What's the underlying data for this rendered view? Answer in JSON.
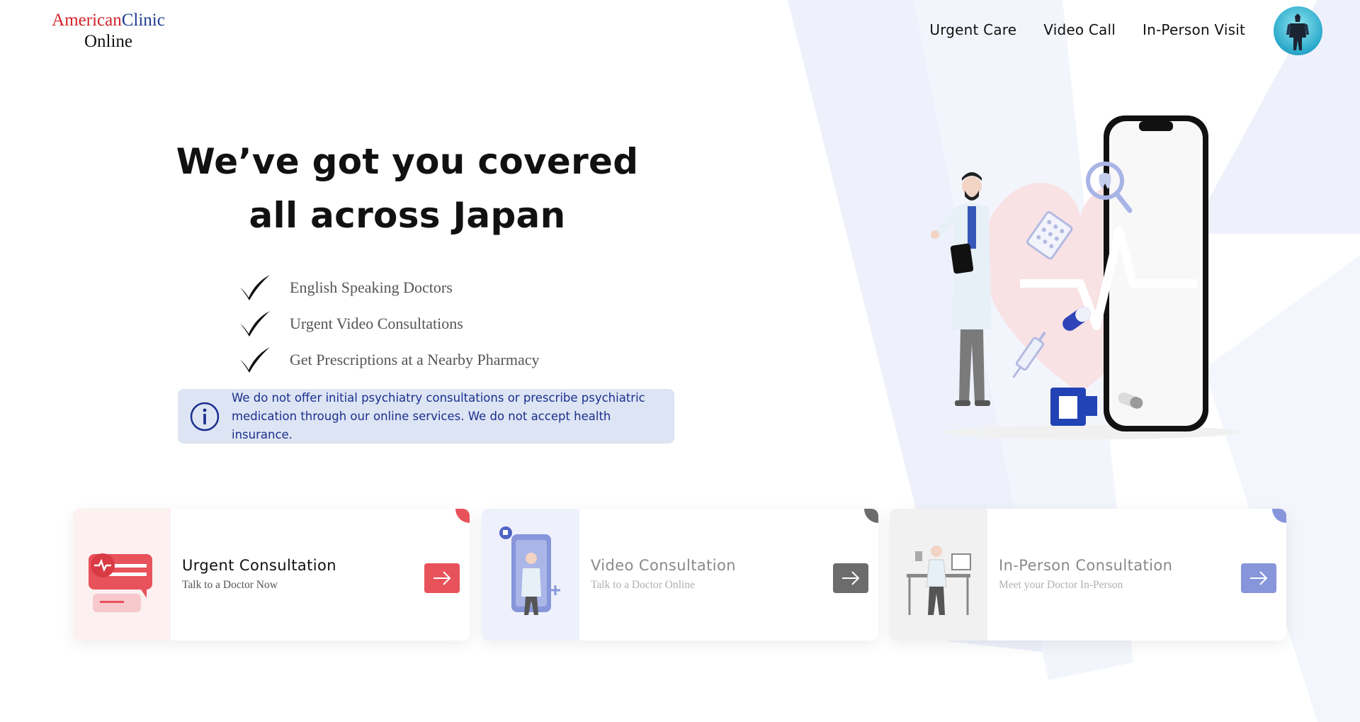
{
  "logo": {
    "line1_a": "American",
    "line1_b": "Clinic",
    "line2": "Online"
  },
  "nav": {
    "items": [
      {
        "label": "Urgent Care"
      },
      {
        "label": "Video Call"
      },
      {
        "label": "In-Person Visit"
      }
    ]
  },
  "hero": {
    "title_line1": "We’ve got you covered",
    "title_line2": "all across Japan",
    "features": [
      "English Speaking Doctors",
      "Urgent Video Consultations",
      "Get Prescriptions at a Nearby Pharmacy"
    ],
    "notice_line1": "We do not offer initial psychiatry consultations or prescribe psychiatric",
    "notice_line2": "medication through our online services. We do not accept health insurance."
  },
  "cards": [
    {
      "title": "Urgent Consultation",
      "subtitle": "Talk to a Doctor Now",
      "accent": "#e8525a",
      "title_color": "#111111",
      "subtitle_color": "#555555",
      "thumb_bg": "#fdf0f0",
      "icon": "chat-heart-icon"
    },
    {
      "title": "Video Consultation",
      "subtitle": "Talk to a Doctor Online",
      "accent": "#6c6c6c",
      "title_color": "#8a8a8a",
      "subtitle_color": "#b0b0b0",
      "thumb_bg": "#eef1fb",
      "icon": "phone-doctor-icon"
    },
    {
      "title": "In-Person Consultation",
      "subtitle": "Meet your Doctor In-Person",
      "accent": "#8796da",
      "title_color": "#8a8a8a",
      "subtitle_color": "#b0b0b0",
      "thumb_bg": "#f1f1f1",
      "icon": "doctor-desk-icon"
    }
  ],
  "colors": {
    "brand_red": "#d2232a",
    "brand_blue": "#1f3c8f",
    "notice_bg": "#dde4f3",
    "notice_text": "#1b2f8f"
  }
}
